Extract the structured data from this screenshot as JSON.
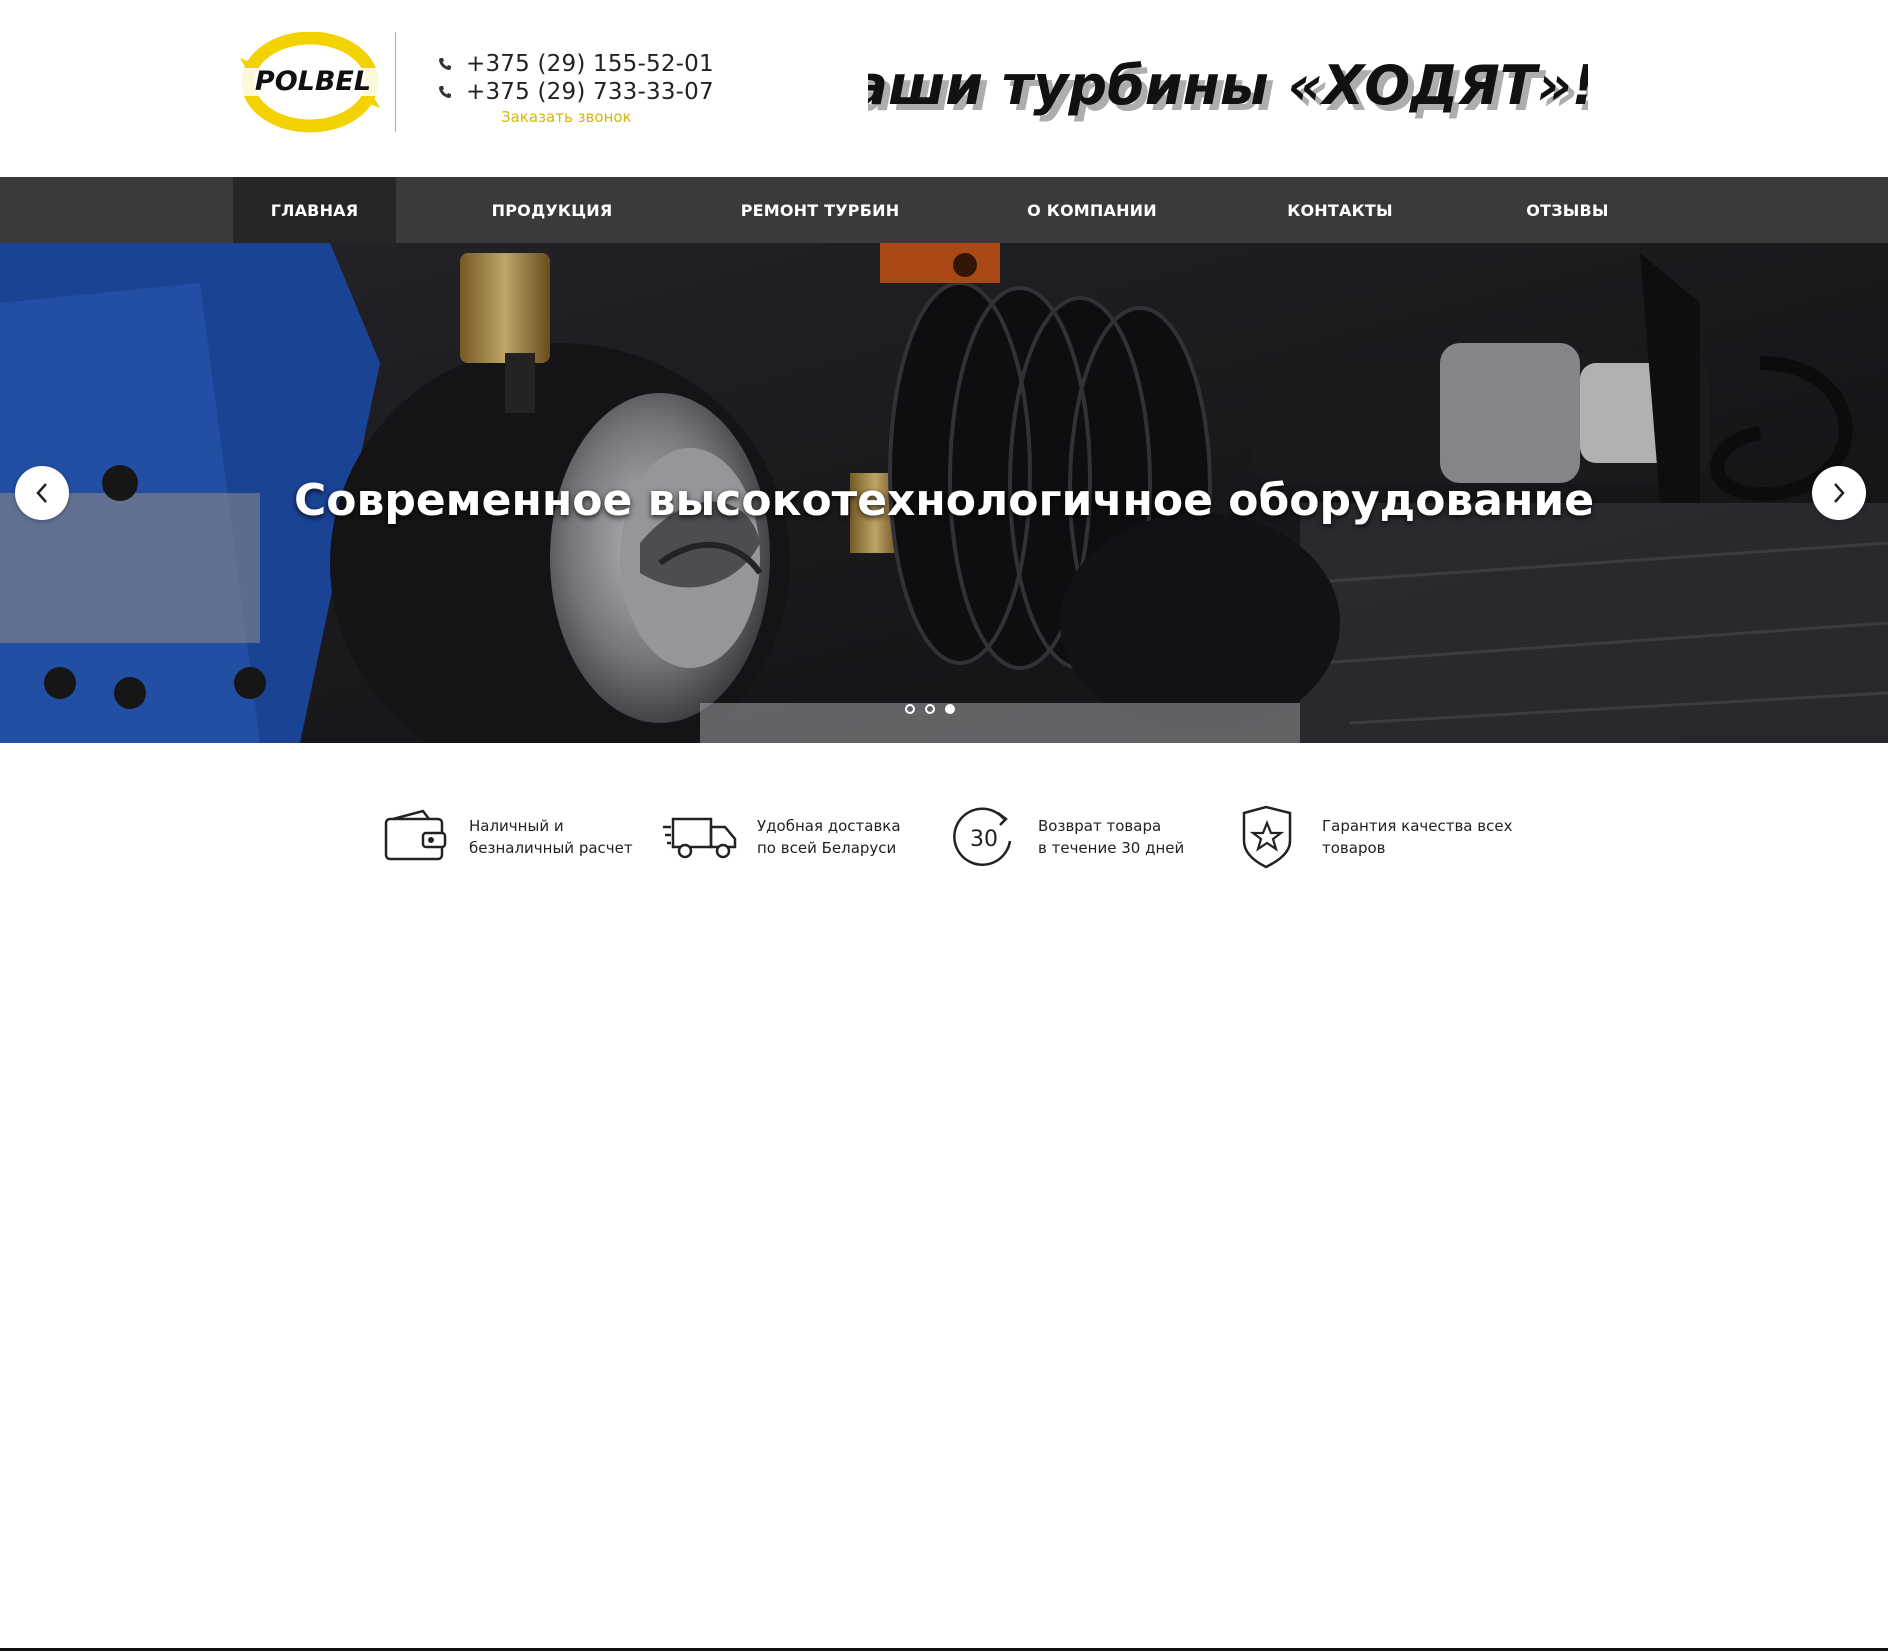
{
  "header": {
    "logo_text": "POLBEL",
    "phones": [
      "+375 (29) 155-52-01",
      "+375 (29) 733-33-07"
    ],
    "callback_label": "Заказать звонок",
    "slogan": "Наши турбины «ХОДЯТ»!!!"
  },
  "nav": {
    "items": [
      {
        "label": "ГЛАВНАЯ",
        "active": true
      },
      {
        "label": "ПРОДУКЦИЯ",
        "active": false
      },
      {
        "label": "РЕМОНТ ТУРБИН",
        "active": false
      },
      {
        "label": "О КОМПАНИИ",
        "active": false
      },
      {
        "label": "КОНТАКТЫ",
        "active": false
      },
      {
        "label": "ОТЗЫВЫ",
        "active": false
      }
    ]
  },
  "hero": {
    "title": "Современное высокотехнологичное оборудование",
    "prev_icon": "chevron-left-icon",
    "next_icon": "chevron-right-icon",
    "slide_count": 3,
    "active_slide": 3
  },
  "features": [
    {
      "icon": "wallet-icon",
      "line1": "Наличный и",
      "line2": "безналичный расчет"
    },
    {
      "icon": "truck-icon",
      "line1": "Удобная доставка",
      "line2": "по всей Беларуси"
    },
    {
      "icon": "return-30-icon",
      "icon_text": "30",
      "line1": "Возврат товара",
      "line2": "в течение 30 дней"
    },
    {
      "icon": "shield-star-icon",
      "line1": "Гарантия качества всех",
      "line2": "товаров"
    }
  ],
  "colors": {
    "accent": "#d4b60a",
    "nav_bg": "#3a3a3a",
    "nav_active_bg": "#262626"
  }
}
